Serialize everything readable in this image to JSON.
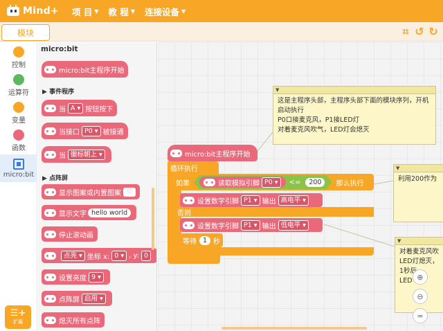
{
  "app": {
    "logo_text": "Mind+"
  },
  "menu": [
    {
      "label": "项 目"
    },
    {
      "label": "教 程"
    },
    {
      "label": "连接设备"
    }
  ],
  "subbar": {
    "module_tab": "模块"
  },
  "categories": [
    {
      "label": "控制",
      "color": "#f7a625"
    },
    {
      "label": "运算符",
      "color": "#5cb85c"
    },
    {
      "label": "变量",
      "color": "#f7a625"
    },
    {
      "label": "函数",
      "color": "#e9697a"
    },
    {
      "label": "micro:bit",
      "color": "#3a7bd5"
    }
  ],
  "extension_button": {
    "label": "扩展"
  },
  "palette": {
    "header": "micro:bit",
    "sections": {
      "events": "事件程序",
      "display": "点阵屏"
    },
    "blocks": {
      "main_start": "micro:bit主程序开始",
      "when_btn": "当",
      "btn_dd": "A",
      "btn_pressed": "按钮按下",
      "when_pin": "当接口",
      "pin_dd": "P0",
      "pin_touched": "被接通",
      "when_gesture": "当",
      "gesture_dd": "徽标朝上",
      "show_image": "显示图案或内置图案",
      "show_text": "显示文字",
      "show_text_val": "hello world",
      "stop_scroll": "停止滚动画",
      "plot_dd": "点亮",
      "plot_x_label": "坐标 x:",
      "plot_x": "0",
      "plot_y_label": ", y:",
      "plot_y": "0",
      "brightness": "设置亮度",
      "brightness_dd": "9",
      "matrix": "点阵屏",
      "matrix_dd": "启用",
      "clear": "熄灭所有点阵"
    }
  },
  "workspace": {
    "main_start": "micro:bit主程序开始",
    "forever": "循环执行",
    "if": "如果",
    "read_analog": "读取模拟引脚",
    "analog_pin": "P0",
    "compare": "<=",
    "threshold": "200",
    "then": "那么执行",
    "set_pin_1": "设置数字引脚",
    "pin_1": "P1",
    "out_1": "输出",
    "level_1": "高电平",
    "else": "否则",
    "set_pin_2": "设置数字引脚",
    "pin_2": "P1",
    "out_2": "输出",
    "level_2": "低电平",
    "wait": "等待",
    "wait_val": "1",
    "wait_unit": "秒",
    "note_main": "这是主程序头部，主程序头部下面的模块序列，开机启动执行\nP0口接麦克风，P1接LED灯\n对着麦克风吹气，LED灯会熄灭",
    "note_right1": "利用200作为",
    "note_right2": "对着麦克风吹\nLED灯熄灭，\n1秒后，\nLED"
  }
}
